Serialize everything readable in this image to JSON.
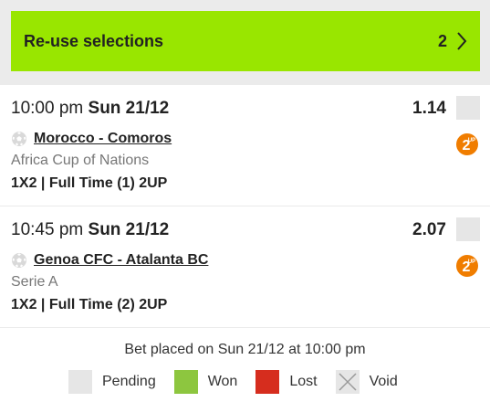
{
  "reuse": {
    "label": "Re-use selections",
    "count": "2"
  },
  "selections": [
    {
      "time": "10:00 pm",
      "date": "Sun 21/12",
      "odds": "1.14",
      "match": "Morocco - Comoros",
      "league": "Africa Cup of Nations",
      "market": "1X2 | Full Time (1) 2UP",
      "badge": "2UP"
    },
    {
      "time": "10:45 pm",
      "date": "Sun 21/12",
      "odds": "2.07",
      "match": "Genoa CFC - Atalanta BC",
      "league": "Serie A",
      "market": "1X2 | Full Time (2) 2UP",
      "badge": "2UP"
    }
  ],
  "footer": {
    "placed": "Bet placed on Sun 21/12 at 10:00 pm",
    "legend": [
      {
        "label": "Pending",
        "color": "#e6e6e6"
      },
      {
        "label": "Won",
        "color": "#8dc63f"
      },
      {
        "label": "Lost",
        "color": "#d62d1e"
      },
      {
        "label": "Void",
        "color": "#e6e6e6"
      }
    ]
  },
  "colors": {
    "accent": "#99e600",
    "badge": "#f07d00"
  }
}
